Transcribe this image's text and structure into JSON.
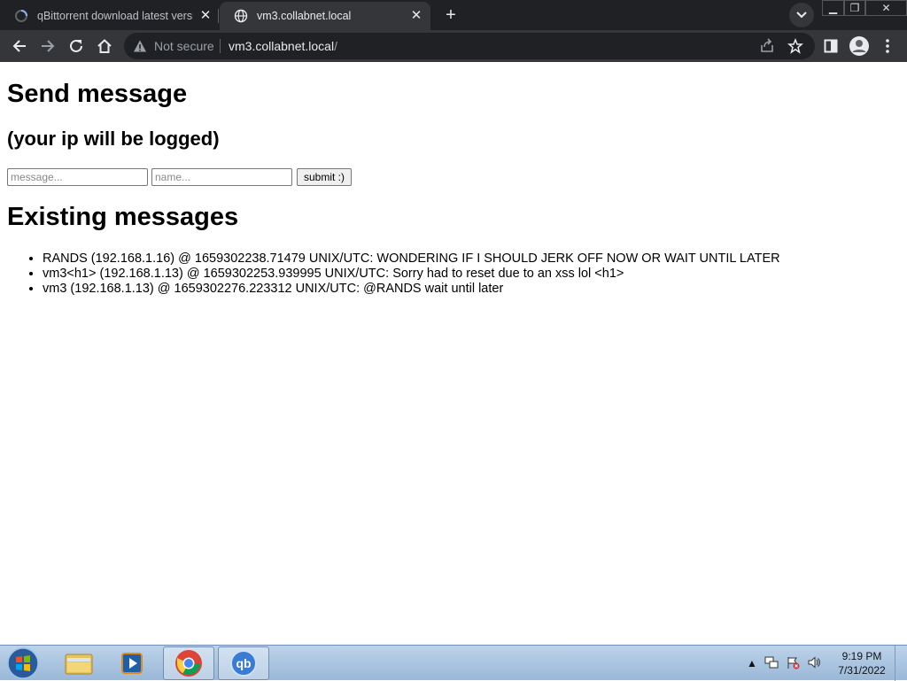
{
  "browser": {
    "tabs": [
      {
        "title": "qBittorrent download latest versi",
        "active": false,
        "favicon": "loading-spinner-icon"
      },
      {
        "title": "vm3.collabnet.local",
        "active": true,
        "favicon": "globe-icon"
      }
    ],
    "new_tab": "+",
    "address": {
      "security": "Not secure",
      "host": "vm3.collabnet.local",
      "path": "/"
    }
  },
  "page": {
    "title": "Send message",
    "subtitle": "(your ip will be logged)",
    "form": {
      "message_placeholder": "message...",
      "name_placeholder": "name...",
      "submit_label": "submit :)"
    },
    "messages_title": "Existing messages",
    "messages": [
      "RANDS (192.168.1.16) @ 1659302238.71479 UNIX/UTC: WONDERING IF I SHOULD JERK OFF NOW OR WAIT UNTIL LATER",
      "vm3<h1> (192.168.1.13) @ 1659302253.939995 UNIX/UTC: Sorry had to reset due to an xss lol <h1>",
      "vm3 (192.168.1.13) @ 1659302276.223312 UNIX/UTC: @RANDS wait until later"
    ]
  },
  "taskbar": {
    "apps": [
      "windows-explorer-icon",
      "media-player-icon",
      "chrome-icon",
      "qbittorrent-icon"
    ],
    "qb_label": "qb",
    "clock": {
      "time": "9:19 PM",
      "date": "7/31/2022"
    }
  },
  "colors": {
    "chrome_dark": "#202124",
    "chrome_toolbar": "#35363a",
    "taskbar": "#9ab8d8"
  }
}
